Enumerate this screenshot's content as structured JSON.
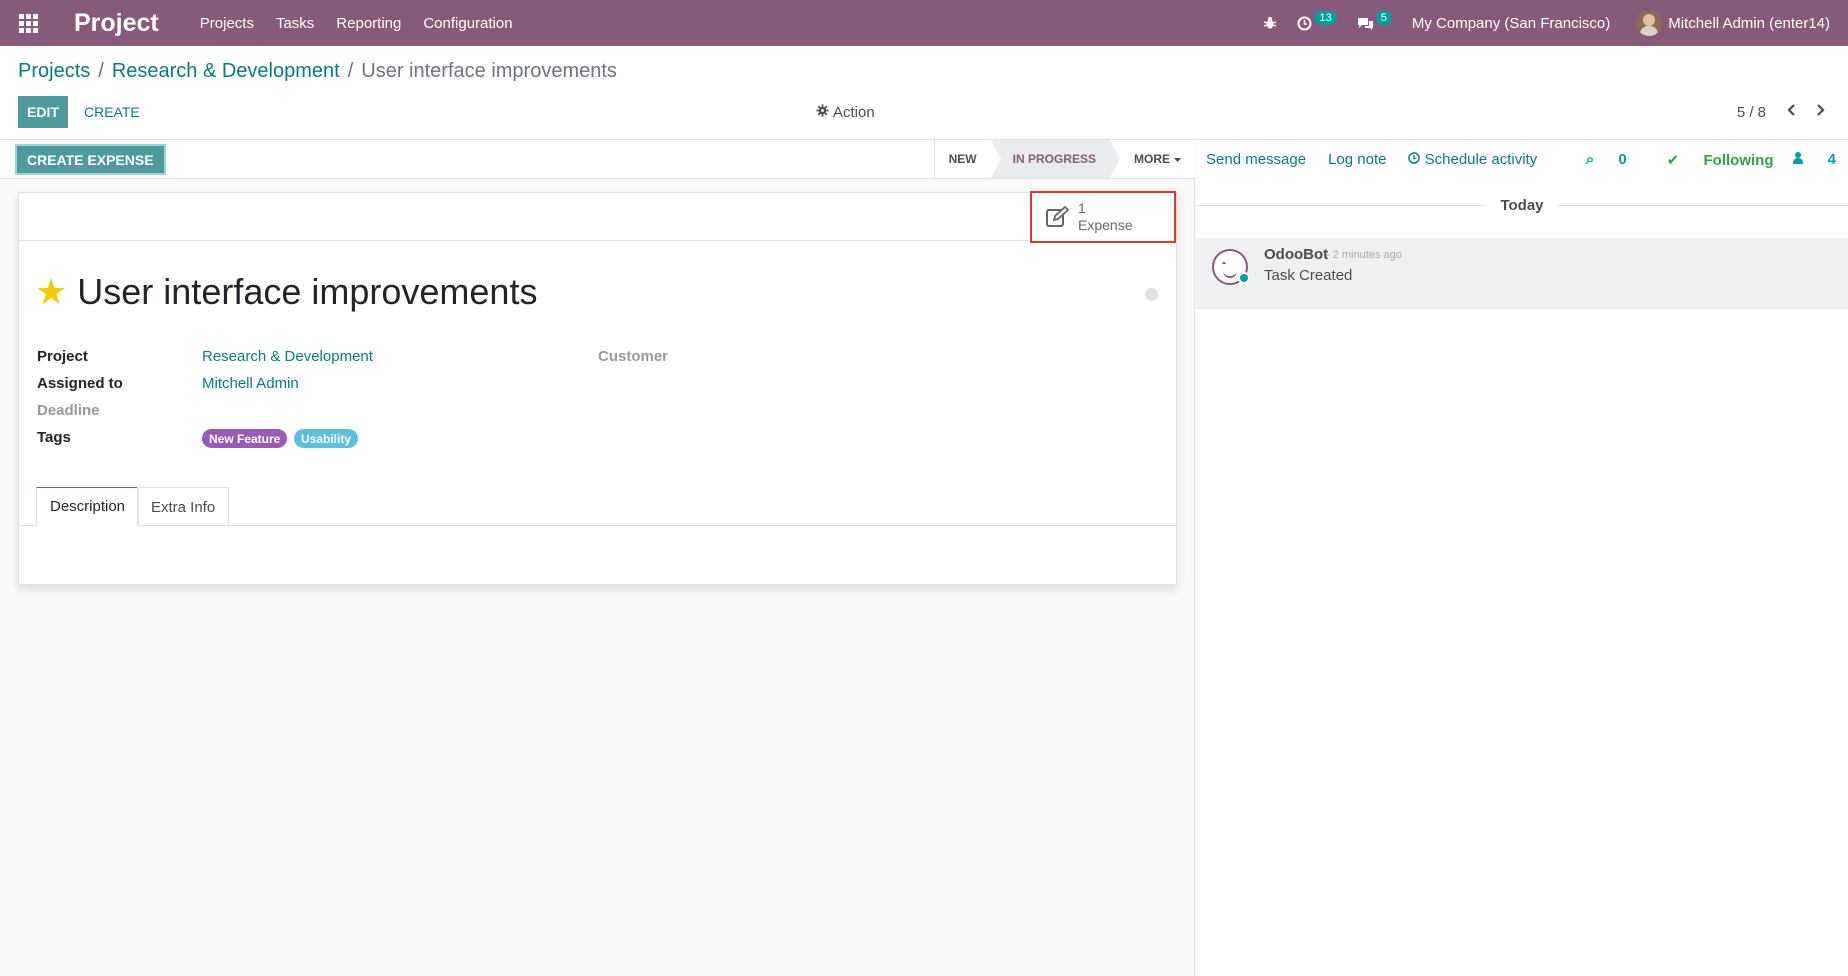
{
  "navbar": {
    "app_name": "Project",
    "menu": [
      "Projects",
      "Tasks",
      "Reporting",
      "Configuration"
    ],
    "activity_count": "13",
    "message_count": "5",
    "company": "My Company (San Francisco)",
    "user": "Mitchell Admin (enter14)"
  },
  "breadcrumb": {
    "root": "Projects",
    "project": "Research & Development",
    "current": "User interface improvements"
  },
  "toolbar": {
    "edit_label": "EDIT",
    "create_label": "CREATE",
    "action_label": "Action",
    "pager": "5 / 8"
  },
  "statusbar": {
    "create_expense_label": "CREATE EXPENSE",
    "stages": [
      "NEW",
      "IN PROGRESS",
      "MORE"
    ],
    "active_stage": "IN PROGRESS"
  },
  "stat_button": {
    "count": "1",
    "label": "Expense"
  },
  "task": {
    "title": "User interface improvements",
    "fields": {
      "project_label": "Project",
      "project_value": "Research & Development",
      "assigned_label": "Assigned to",
      "assigned_value": "Mitchell Admin",
      "deadline_label": "Deadline",
      "tags_label": "Tags",
      "customer_label": "Customer"
    },
    "tags": [
      {
        "name": "New Feature",
        "color": "#9b59b6"
      },
      {
        "name": "Usability",
        "color": "#5bc0de"
      }
    ]
  },
  "tabs": [
    "Description",
    "Extra Info"
  ],
  "chatter": {
    "send_message": "Send message",
    "log_note": "Log note",
    "schedule_activity": "Schedule activity",
    "attachments": "0",
    "following": "Following",
    "followers": "4",
    "date_separator": "Today",
    "messages": [
      {
        "author": "OdooBot",
        "time": "- 2 minutes ago",
        "body": "Task Created"
      }
    ]
  },
  "colors": {
    "brand": "#875a7b",
    "accent": "#017e84",
    "button": "#4f9b9b",
    "highlight": "#e0372a"
  }
}
